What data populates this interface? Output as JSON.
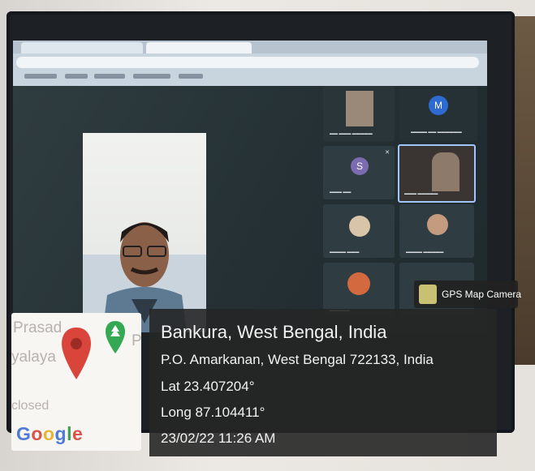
{
  "location": {
    "city_line": "Bankura, West Bengal, India",
    "address_line": "P.O. Amarkanan, West Bengal 722133, India",
    "lat": "Lat 23.407204°",
    "long": "Long 87.104411°",
    "datetime": "23/02/22 11:26 AM"
  },
  "badge": {
    "label": "GPS Map Camera"
  },
  "map_snippet": {
    "text_top": "Prasad",
    "text_mid": "yalaya",
    "text_p": "P",
    "text_closed": "closed",
    "google_letters": [
      "G",
      "o",
      "o",
      "g",
      "l",
      "e"
    ]
  },
  "meeting": {
    "tile_letter_m": "M",
    "tile_letter_s": "S"
  },
  "colors": {
    "overlay_bg": "#262626",
    "pin_red": "#d9453b",
    "pin_green": "#34a853",
    "meet_bg": "#243034"
  },
  "icons": [
    "map-pin-icon",
    "park-pin-icon",
    "gps-map-camera-icon",
    "mic-off-icon"
  ]
}
